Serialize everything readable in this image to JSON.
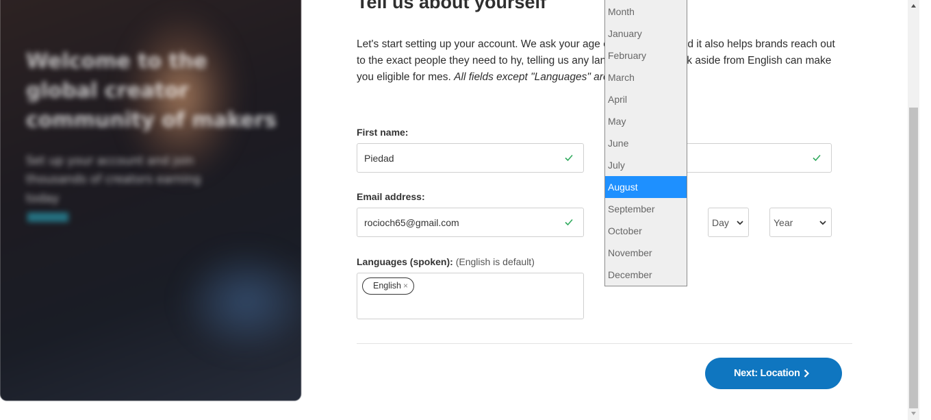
{
  "page": {
    "title": "Tell us about yourself",
    "intro_plain": "Let's start setting up your account. We ask your age ",
    "intro_mid": "et privacy laws and it also helps brands reach out to the exact people they need to h",
    "intro_mid2": "y, telling us any languages you speak aside from English can make you eligible for m",
    "intro_tail": "es. ",
    "intro_italic": "All fields except \"Languages\" are required."
  },
  "form": {
    "first_name_label": "First name:",
    "first_name_value": "Piedad",
    "last_name_value": "",
    "email_label": "Email address:",
    "email_value": "rocioch65@gmail.com",
    "day_select": "Day",
    "year_select": "Year",
    "languages_label": "Languages (spoken):",
    "languages_hint": "(English is default)",
    "language_chips": [
      "English"
    ],
    "chip_remove": "×",
    "next_button": "Next: Location"
  },
  "month_dropdown": {
    "options": [
      "Month",
      "January",
      "February",
      "March",
      "April",
      "May",
      "June",
      "July",
      "August",
      "September",
      "October",
      "November",
      "December"
    ],
    "selected": "August"
  },
  "colors": {
    "accent": "#0f76c0",
    "selected_option": "#1e90ff",
    "valid_check": "#2eaa5c"
  },
  "icons": {
    "valid": "check-icon",
    "next": "chevron-right-icon",
    "select": "chevron-down-icon",
    "remove": "close-icon"
  }
}
